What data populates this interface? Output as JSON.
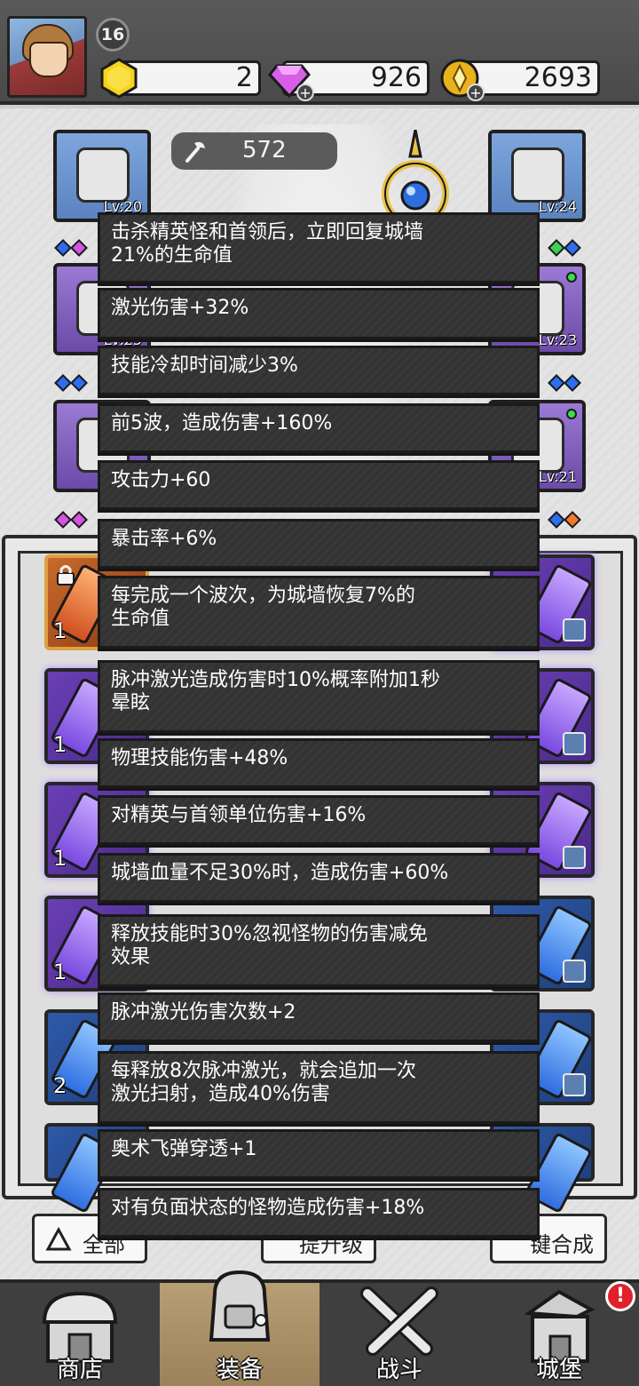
{
  "header": {
    "level": "16",
    "resources": [
      {
        "name": "gold-gem",
        "icon": "hexagon-gold-icon",
        "value": "2",
        "has_plus": false
      },
      {
        "name": "diamond",
        "icon": "diamond-icon",
        "value": "926",
        "has_plus": true
      },
      {
        "name": "coin",
        "icon": "coin-icon",
        "value": "2693",
        "has_plus": true
      }
    ]
  },
  "stage": {
    "attack_power": "572",
    "slots": [
      {
        "side": "left",
        "level": "Lv:20"
      },
      {
        "side": "left",
        "level": "Lv:25"
      },
      {
        "side": "left",
        "level": ""
      },
      {
        "side": "right",
        "level": "Lv:24"
      },
      {
        "side": "right",
        "level": "Lv:23"
      },
      {
        "side": "right",
        "level": "Lv:21"
      }
    ]
  },
  "inventory": {
    "counts": [
      "1",
      "1",
      "1",
      "1",
      "2"
    ],
    "actions": {
      "filter_label": "全部",
      "upgrade_label": "提升级",
      "merge_label": "键合成"
    }
  },
  "tooltips": [
    {
      "lines": [
        "击杀精英怪和首领后，立即回复城墙",
        "21%的生命值"
      ]
    },
    {
      "lines": [
        "激光伤害+32%"
      ]
    },
    {
      "lines": [
        "技能冷却时间减少3%"
      ]
    },
    {
      "lines": [
        "前5波，造成伤害+160%"
      ]
    },
    {
      "lines": [
        "攻击力+60"
      ]
    },
    {
      "lines": [
        "暴击率+6%"
      ]
    },
    {
      "lines": [
        "每完成一个波次，为城墙恢复7%的",
        "生命值"
      ]
    },
    {
      "lines": [
        "脉冲激光造成伤害时10%概率附加1秒",
        "晕眩"
      ]
    },
    {
      "lines": [
        "物理技能伤害+48%"
      ]
    },
    {
      "lines": [
        "对精英与首领单位伤害+16%"
      ]
    },
    {
      "lines": [
        "城墙血量不足30%时，造成伤害+60%"
      ]
    },
    {
      "lines": [
        "释放技能时30%忽视怪物的伤害减免",
        "效果"
      ]
    },
    {
      "lines": [
        "脉冲激光伤害次数+2"
      ]
    },
    {
      "lines": [
        "每释放8次脉冲激光，就会追加一次",
        "激光扫射，造成40%伤害"
      ]
    },
    {
      "lines": [
        "奥术飞弹穿透+1"
      ]
    },
    {
      "lines": [
        "对有负面状态的怪物造成伤害+18%"
      ]
    }
  ],
  "nav": {
    "tabs": [
      {
        "label": "商店",
        "icon": "shop-icon",
        "active": false
      },
      {
        "label": "装备",
        "icon": "backpack-icon",
        "active": true
      },
      {
        "label": "战斗",
        "icon": "crossed-swords-icon",
        "active": false
      },
      {
        "label": "城堡",
        "icon": "castle-icon",
        "active": false
      }
    ],
    "alert": "!"
  },
  "colors": {
    "tooltip_bg": "#333333",
    "purple_rarity": "#6a3fb5",
    "blue_rarity": "#2e5aa8",
    "alert_red": "#e2202a"
  }
}
